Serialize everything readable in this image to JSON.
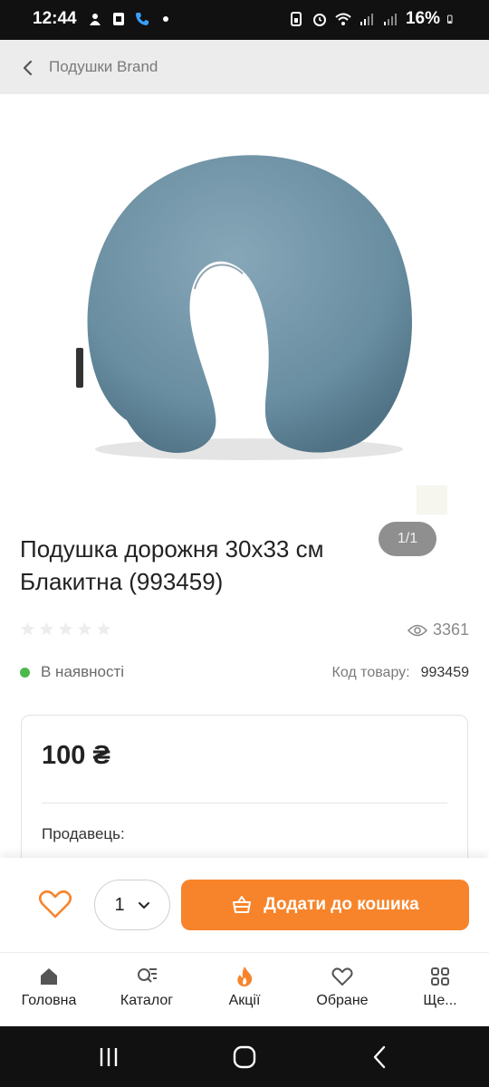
{
  "status_bar": {
    "time": "12:44",
    "battery": "16%"
  },
  "header": {
    "breadcrumb": "Подушки Brand"
  },
  "gallery": {
    "counter": "1/1"
  },
  "product": {
    "title_line1": "Подушка дорожня 30х33 см",
    "title_line2": "Блакитна (993459)",
    "rating": 0,
    "views": "3361",
    "stock": "В наявності",
    "code_label": "Код товару:",
    "code_value": "993459",
    "price": "100 ₴",
    "seller_label": "Продавець:"
  },
  "actions": {
    "quantity": "1",
    "add_to_cart": "Додати до кошика"
  },
  "bottom_nav": [
    {
      "label": "Головна",
      "icon": "home-icon"
    },
    {
      "label": "Каталог",
      "icon": "catalog-search-icon"
    },
    {
      "label": "Акції",
      "icon": "fire-icon"
    },
    {
      "label": "Обране",
      "icon": "heart-icon"
    },
    {
      "label": "Ще...",
      "icon": "grid-icon"
    }
  ],
  "colors": {
    "accent": "#f7842b",
    "in_stock": "#4bb94b",
    "pillow": "#6f93a6"
  }
}
